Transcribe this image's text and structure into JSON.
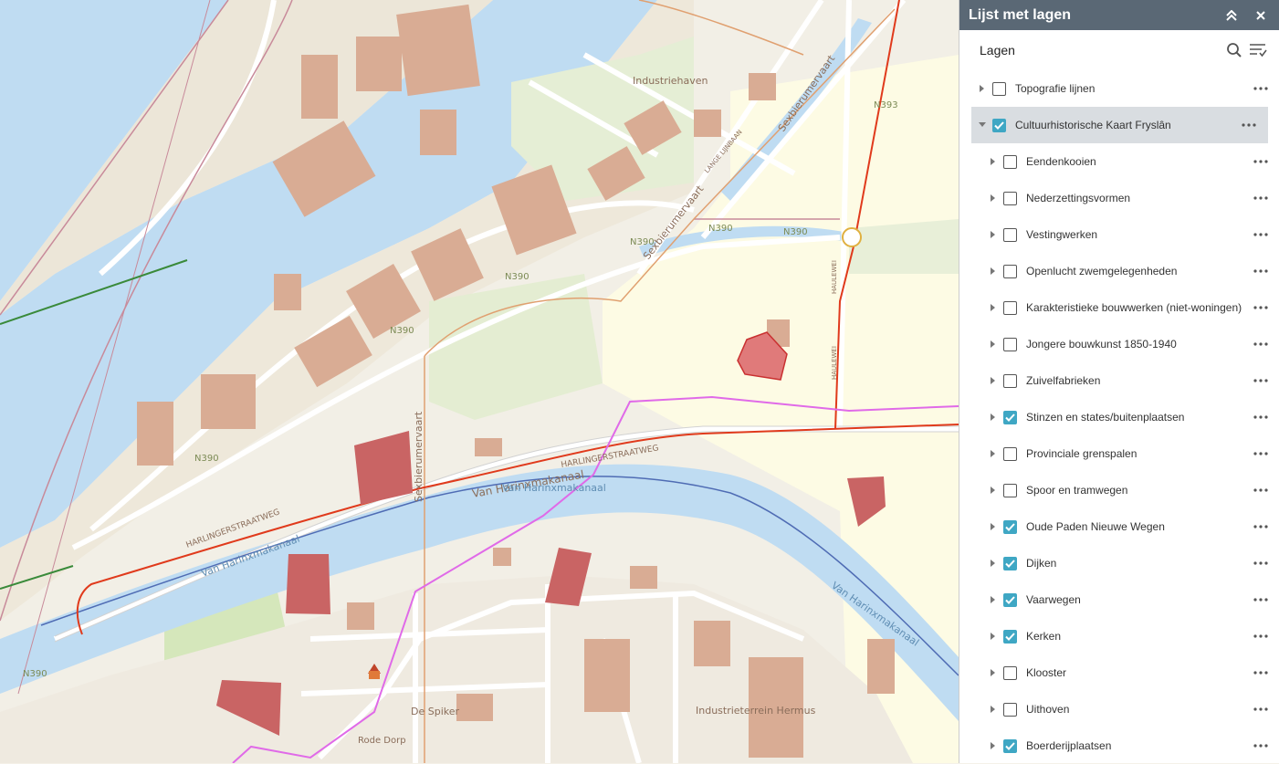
{
  "panel": {
    "title": "Lijst met lagen",
    "subheader": "Lagen",
    "collapse_icon": "double-chevron-up-icon",
    "close_icon": "close-icon",
    "search_icon": "search-icon",
    "filter_icon": "filter-list-icon",
    "accent_color": "#3fa7c4",
    "header_color": "#5a6875"
  },
  "layers": [
    {
      "name": "Topografie lijnen",
      "checked": false,
      "expanded": false,
      "level": 0
    },
    {
      "name": "Cultuurhistorische Kaart Fryslân",
      "checked": true,
      "expanded": true,
      "level": 0,
      "selected": true
    },
    {
      "name": "Eendenkooien",
      "checked": false,
      "expanded": false,
      "level": 1
    },
    {
      "name": "Nederzettingsvormen",
      "checked": false,
      "expanded": false,
      "level": 1
    },
    {
      "name": "Vestingwerken",
      "checked": false,
      "expanded": false,
      "level": 1
    },
    {
      "name": "Openlucht zwemgelegenheden",
      "checked": false,
      "expanded": false,
      "level": 1
    },
    {
      "name": "Karakteristieke bouwwerken (niet-woningen)",
      "checked": false,
      "expanded": false,
      "level": 1
    },
    {
      "name": "Jongere bouwkunst 1850-1940",
      "checked": false,
      "expanded": false,
      "level": 1
    },
    {
      "name": "Zuivelfabrieken",
      "checked": false,
      "expanded": false,
      "level": 1
    },
    {
      "name": "Stinzen en states/buitenplaatsen",
      "checked": true,
      "expanded": false,
      "level": 1
    },
    {
      "name": "Provinciale grenspalen",
      "checked": false,
      "expanded": false,
      "level": 1
    },
    {
      "name": "Spoor en tramwegen",
      "checked": false,
      "expanded": false,
      "level": 1
    },
    {
      "name": "Oude Paden Nieuwe Wegen",
      "checked": true,
      "expanded": false,
      "level": 1
    },
    {
      "name": "Dijken",
      "checked": true,
      "expanded": false,
      "level": 1
    },
    {
      "name": "Vaarwegen",
      "checked": true,
      "expanded": false,
      "level": 1
    },
    {
      "name": "Kerken",
      "checked": true,
      "expanded": false,
      "level": 1
    },
    {
      "name": "Klooster",
      "checked": false,
      "expanded": false,
      "level": 1
    },
    {
      "name": "Uithoven",
      "checked": false,
      "expanded": false,
      "level": 1
    },
    {
      "name": "Boerderijplaatsen",
      "checked": true,
      "expanded": false,
      "level": 1
    }
  ],
  "map": {
    "labels": {
      "industriehaven": "Industriehaven",
      "lange_lijnbaan": "LANGE LIJNBAAN",
      "sexbierumervaart_1": "Sexbierumervaart",
      "sexbierumervaart_2": "Sexbierumervaart",
      "sexbierumervaart_3": "Sexbierumervaart",
      "n390_a": "N390",
      "n390_b": "N390",
      "n390_c": "N390",
      "n390_d": "N390",
      "n390_e": "N390",
      "n390_f": "N390",
      "n393": "N393",
      "haulewei_1": "HAULEWEI",
      "haulewei_2": "HAULEWEI",
      "harlingerstraatweg_1": "HARLINGERSTRAATWEG",
      "harlingerstraatweg_2": "HARLINGERSTRAATWEG",
      "van_harinxmakanaal_1": "Van Harinxmakanaal",
      "van_harinxmakanaal_2": "Van Harinxmakanaal",
      "van_harinxmakanaal_3": "Van Harinxmakanaal",
      "van_harinxmakanaal_4": "Van Harinxmakanaal",
      "de_spiker": "De Spiker",
      "rode_dorp": "Rode Dorp",
      "industrieterrein_hermus": "Industrieterrein Hermus"
    },
    "colors": {
      "water": "#bfdcf2",
      "land": "#f2efe6",
      "green": "#dfeacb",
      "building": "#d9ac94",
      "stins": "#c96464",
      "road_red": "#e03a1c",
      "route_magenta": "#e06ae8",
      "vaarweg_blue": "#4f6cb4"
    }
  }
}
